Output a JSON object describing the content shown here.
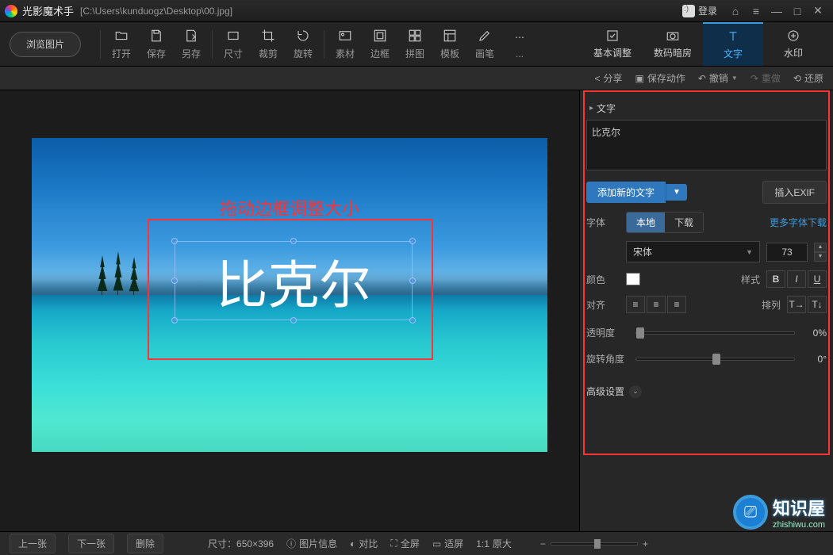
{
  "app": {
    "title": "光影魔术手",
    "filepath": "[C:\\Users\\kunduogz\\Desktop\\00.jpg]",
    "login": "登录"
  },
  "toolbar": {
    "browse": "浏览图片",
    "items": [
      "打开",
      "保存",
      "另存",
      "尺寸",
      "裁剪",
      "旋转",
      "素材",
      "边框",
      "拼图",
      "模板",
      "画笔",
      "..."
    ],
    "rtabs": {
      "basic": "基本调整",
      "darkroom": "数码暗房",
      "text": "文字",
      "watermark": "水印"
    }
  },
  "subbar": {
    "share": "分享",
    "saveaction": "保存动作",
    "undo": "撤销",
    "redo": "重做",
    "restore": "还原"
  },
  "image": {
    "annotation": "拖动边框调整大小",
    "overlay_text": "比克尔"
  },
  "panel": {
    "header": "文字",
    "text_input": "比克尔",
    "add_text": "添加新的文字",
    "insert_exif": "插入EXIF",
    "font_label": "字体",
    "font_tab_local": "本地",
    "font_tab_download": "下载",
    "more_fonts": "更多字体下载",
    "font_name": "宋体",
    "font_size": "73",
    "color_label": "颜色",
    "style_label": "样式",
    "align_label": "对齐",
    "arrange_label": "排列",
    "opacity_label": "透明度",
    "opacity_val": "0%",
    "rotate_label": "旋转角度",
    "rotate_val": "0°",
    "advanced": "高级设置"
  },
  "status": {
    "prev": "上一张",
    "next": "下一张",
    "delete": "删除",
    "dims": "尺寸：650×396",
    "info": "图片信息",
    "compare": "对比",
    "fullscreen": "全屏",
    "fit": "适屏",
    "orig": "原大"
  },
  "brand": {
    "name": "知识屋",
    "url": "zhishiwu.com"
  }
}
